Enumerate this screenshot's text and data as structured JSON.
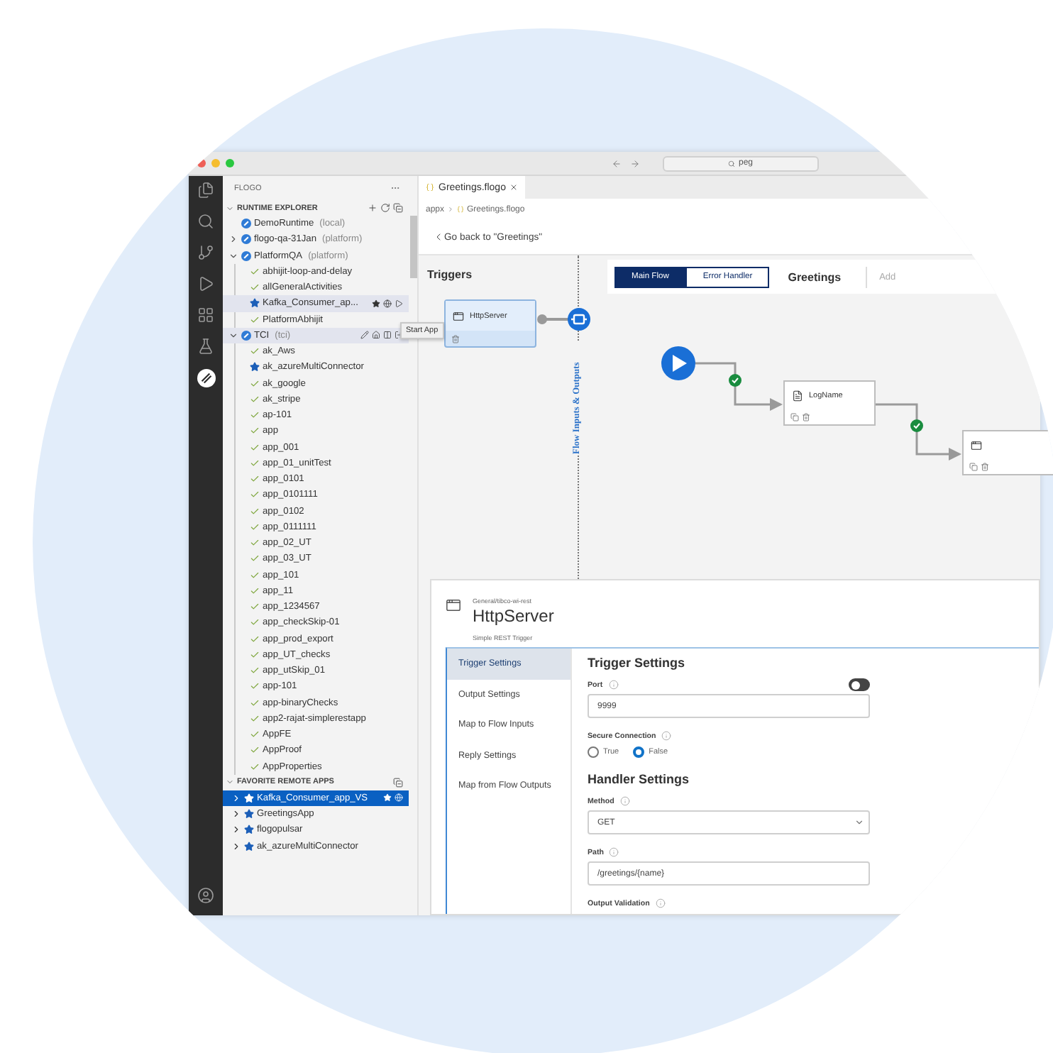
{
  "address_bar": {
    "value": "peg"
  },
  "sidebar": {
    "title": "FLOGO",
    "runtime_explorer": {
      "title": "RUNTIME EXPLORER",
      "runtimes": [
        {
          "name": "DemoRuntime",
          "type": "(local)",
          "hovered": false
        },
        {
          "name": "flogo-qa-31Jan",
          "type": "(platform)",
          "expanded": false,
          "hovered": false
        },
        {
          "name": "PlatformQA",
          "type": "(platform)",
          "expanded": true,
          "hovered": false,
          "apps": [
            {
              "name": "abhijit-loop-and-delay",
              "favorite": false,
              "hovered": false
            },
            {
              "name": "allGeneralActivities",
              "favorite": false,
              "hovered": false
            },
            {
              "name": "Kafka_Consumer_ap...",
              "favorite": true,
              "hovered": true
            },
            {
              "name": "PlatformAbhijit",
              "favorite": false,
              "hovered": false
            }
          ]
        },
        {
          "name": "TCI",
          "type": "(tci)",
          "expanded": true,
          "hovered": true,
          "apps": [
            {
              "name": "ak_Aws",
              "favorite": false,
              "hovered": false
            },
            {
              "name": "ak_azureMultiConnector",
              "favorite": true,
              "hovered": false
            },
            {
              "name": "ak_google",
              "favorite": false,
              "hovered": false
            },
            {
              "name": "ak_stripe",
              "favorite": false,
              "hovered": false
            },
            {
              "name": "ap-101",
              "favorite": false,
              "hovered": false
            },
            {
              "name": "app",
              "favorite": false,
              "hovered": false
            },
            {
              "name": "app_001",
              "favorite": false,
              "hovered": false
            },
            {
              "name": "app_01_unitTest",
              "favorite": false,
              "hovered": false
            },
            {
              "name": "app_0101",
              "favorite": false,
              "hovered": false
            },
            {
              "name": "app_0101111",
              "favorite": false,
              "hovered": false
            },
            {
              "name": "app_0102",
              "favorite": false,
              "hovered": false
            },
            {
              "name": "app_0111111",
              "favorite": false,
              "hovered": false
            },
            {
              "name": "app_02_UT",
              "favorite": false,
              "hovered": false
            },
            {
              "name": "app_03_UT",
              "favorite": false,
              "hovered": false
            },
            {
              "name": "app_101",
              "favorite": false,
              "hovered": false
            },
            {
              "name": "app_11",
              "favorite": false,
              "hovered": false
            },
            {
              "name": "app_1234567",
              "favorite": false,
              "hovered": false
            },
            {
              "name": "app_checkSkip-01",
              "favorite": false,
              "hovered": false
            },
            {
              "name": "app_prod_export",
              "favorite": false,
              "hovered": false
            },
            {
              "name": "app_UT_checks",
              "favorite": false,
              "hovered": false
            },
            {
              "name": "app_utSkip_01",
              "favorite": false,
              "hovered": false
            },
            {
              "name": "app-101",
              "favorite": false,
              "hovered": false
            },
            {
              "name": "app-binaryChecks",
              "favorite": false,
              "hovered": false
            },
            {
              "name": "app2-rajat-simplerestapp",
              "favorite": false,
              "hovered": false
            },
            {
              "name": "AppFE",
              "favorite": false,
              "hovered": false
            },
            {
              "name": "AppProof",
              "favorite": false,
              "hovered": false
            },
            {
              "name": "AppProperties",
              "favorite": false,
              "hovered": false
            }
          ]
        }
      ]
    },
    "tooltip": {
      "text": "Start App"
    },
    "favorites": {
      "title": "FAVORITE REMOTE APPS",
      "items": [
        {
          "name": "Kafka_Consumer_app_VS",
          "selected": true
        },
        {
          "name": "GreetingsApp",
          "selected": false
        },
        {
          "name": "flogopulsar",
          "selected": false
        },
        {
          "name": "ak_azureMultiConnector",
          "selected": false
        }
      ]
    }
  },
  "editor": {
    "tab": {
      "label": "Greetings.flogo"
    },
    "breadcrumb": [
      "appx",
      "Greetings.flogo"
    ],
    "back_link": "Go back to \"Greetings\"",
    "triggers": {
      "title": "Triggers",
      "items": [
        {
          "name": "HttpServer"
        }
      ]
    },
    "flow_io_label": "Flow Inputs & Outputs",
    "flow_tabs": [
      {
        "label": "Main Flow",
        "selected": true
      },
      {
        "label": "Error Handler",
        "selected": false
      }
    ],
    "flow_name": "Greetings",
    "add_label": "Add",
    "activities": [
      {
        "kind": "log",
        "name": "LogName"
      },
      {
        "kind": "mapper"
      }
    ]
  },
  "panel": {
    "category": "General/tibco-wi-rest",
    "title": "HttpServer",
    "subtitle": "Simple REST Trigger",
    "nav": [
      {
        "label": "Trigger Settings",
        "selected": true
      },
      {
        "label": "Output Settings",
        "selected": false
      },
      {
        "label": "Map to Flow Inputs",
        "selected": false
      },
      {
        "label": "Reply Settings",
        "selected": false
      },
      {
        "label": "Map from Flow Outputs",
        "selected": false
      }
    ],
    "sections": [
      {
        "title": "Trigger Settings",
        "fields": [
          {
            "kind": "text",
            "label": "Port",
            "value": "9999",
            "toggle_on": false
          },
          {
            "kind": "radio",
            "label": "Secure Connection",
            "options": [
              {
                "label": "True",
                "selected": false
              },
              {
                "label": "False",
                "selected": true
              }
            ]
          }
        ]
      },
      {
        "title": "Handler Settings",
        "fields": [
          {
            "kind": "select",
            "label": "Method",
            "value": "GET"
          },
          {
            "kind": "text",
            "label": "Path",
            "value": "/greetings/{name}"
          },
          {
            "kind": "label",
            "label": "Output Validation"
          }
        ]
      }
    ]
  }
}
